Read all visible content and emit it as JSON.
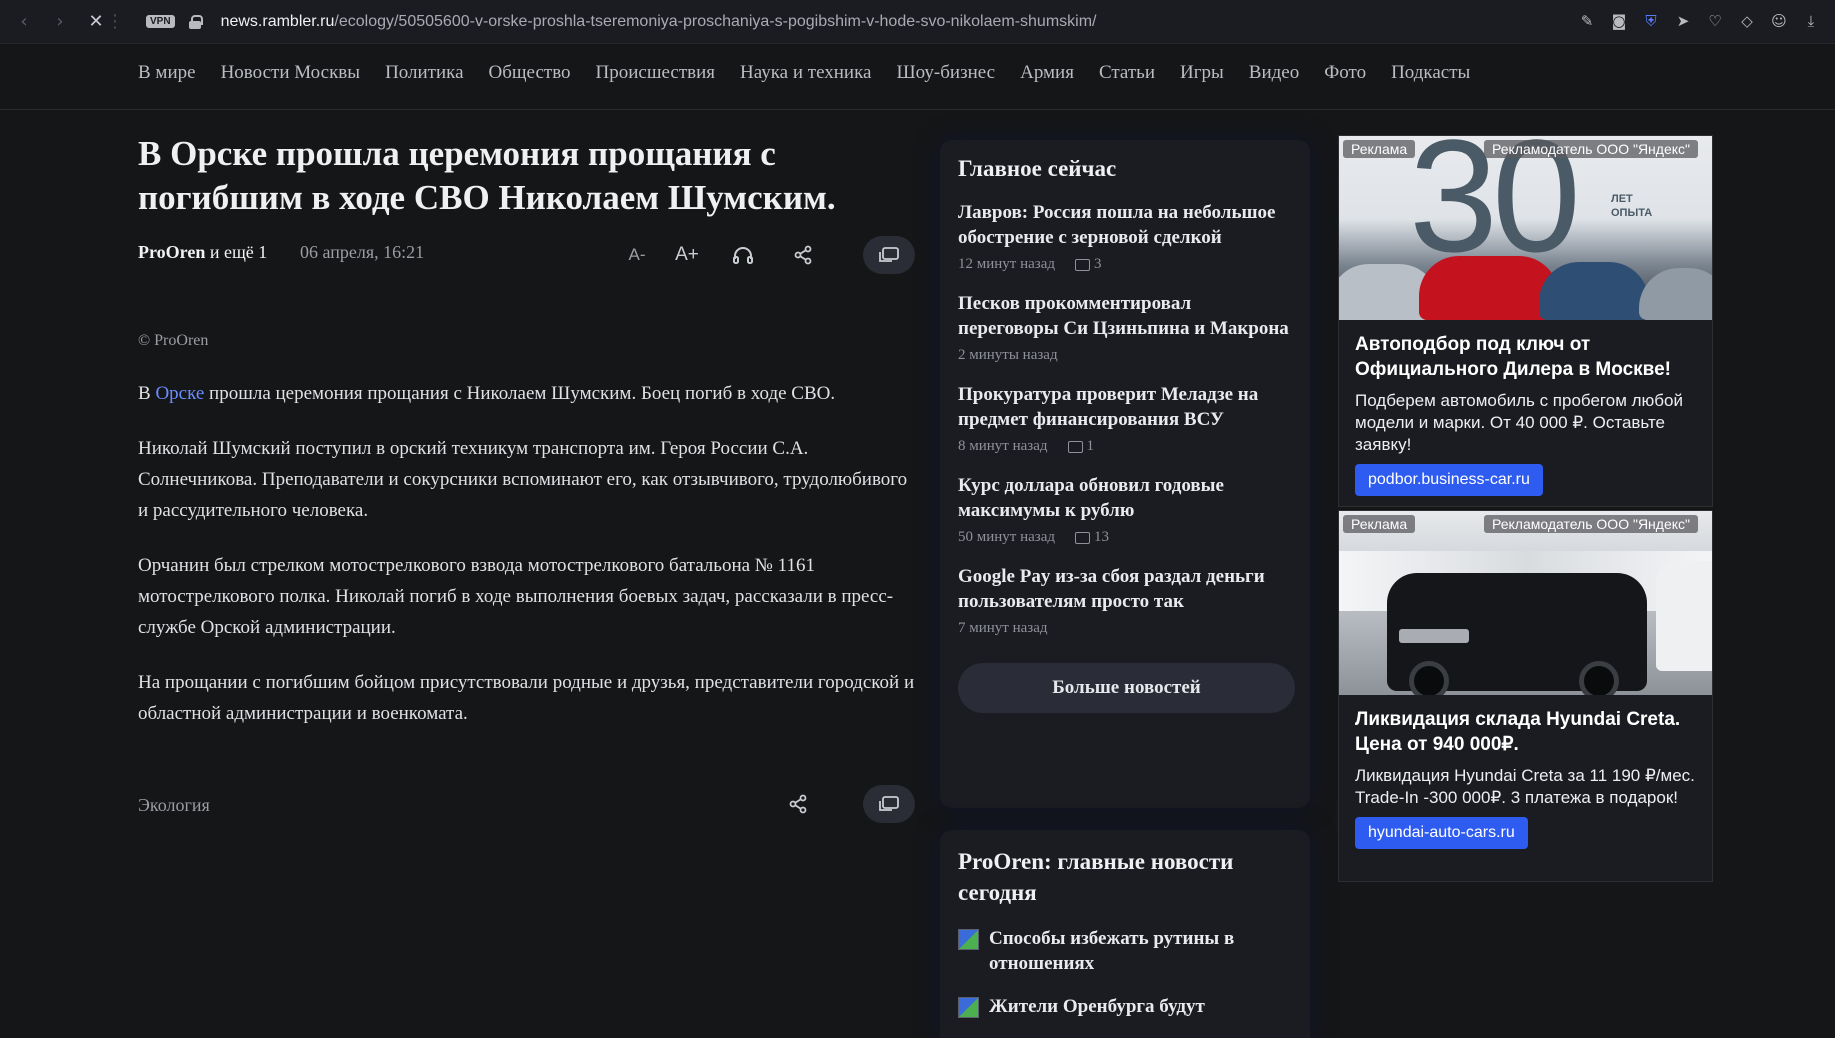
{
  "browser": {
    "vpn_label": "VPN",
    "url_domain": "news.rambler.ru",
    "url_path": "/ecology/50505600-v-orske-proshla-tseremoniya-proschaniya-s-pogibshim-v-hode-svo-nikolaem-shumskim/"
  },
  "nav": {
    "items": [
      "В мире",
      "Новости Москвы",
      "Политика",
      "Общество",
      "Происшествия",
      "Наука и техника",
      "Шоу-бизнес",
      "Армия",
      "Статьи",
      "Игры",
      "Видео",
      "Фото",
      "Подкасты"
    ]
  },
  "article": {
    "headline": "В Орске прошла церемония прощания с погибшим в ходе СВО Николаем Шумским.",
    "source": "ProOren",
    "source_more": "и ещё 1",
    "date": "06 апреля, 16:21",
    "font_minus": "A-",
    "font_plus": "A+",
    "copyright": "© ProOren",
    "p1_before": "В ",
    "p1_link": "Орске",
    "p1_after": " прошла церемония прощания с Николаем Шумским. Боец погиб в ходе СВО.",
    "p2": "Николай Шумский поступил в орский техникум транспорта им. Героя России С.А. Солнечникова. Преподаватели и сокурсники вспоминают его, как отзывчивого, трудолюбивого и рассудительного человека.",
    "p3": "Орчанин был стрелком мотострелкового взвода мотострелкового батальона № 1161 мотострелкового полка. Николай погиб в ходе выполнения боевых задач, рассказали в пресс-службе Орской администрации.",
    "p4": "На прощании с погибшим бойцом присутствовали родные и друзья, представители городской и областной администрации и военкомата.",
    "rubric": "Экология"
  },
  "main_now": {
    "title": "Главное сейчас",
    "items": [
      {
        "title": "Лавров: Россия пошла на небольшое обострение с зерновой сделкой",
        "time": "12 минут назад",
        "comments": "3"
      },
      {
        "title": "Песков прокомментировал переговоры Си Цзиньпина и Макрона",
        "time": "2 минуты назад",
        "comments": ""
      },
      {
        "title": "Прокуратура проверит Меладзе на предмет финансирования ВСУ",
        "time": "8 минут назад",
        "comments": "1"
      },
      {
        "title": "Курс доллара обновил годовые максимумы к рублю",
        "time": "50 минут назад",
        "comments": "13"
      },
      {
        "title": "Google Pay из-за сбоя раздал деньги пользователям просто так",
        "time": "7 минут назад",
        "comments": ""
      }
    ],
    "more_button": "Больше новостей"
  },
  "prooren": {
    "title": "ProOren: главные новости сегодня",
    "items": [
      "Способы избежать рутины в отношениях",
      "Жители Оренбурга будут"
    ]
  },
  "ads": [
    {
      "label": "Реклама",
      "advertiser": "Рекламодатель ООО \"Яндекс\"",
      "big_number": "30",
      "badge_line1": "ЛЕТ",
      "badge_line2": "ОПЫТА",
      "title": "Автоподбор под ключ от Официального Дилера в Москве!",
      "text": "Подберем автомобиль с пробегом любой модели и марки. От 40 000 ₽. Оставьте заявку!",
      "button": "podbor.business-car.ru"
    },
    {
      "label": "Реклама",
      "advertiser": "Рекламодатель ООО \"Яндекс\"",
      "title": "Ликвидация склада Hyundai Creta. Цена от 940 000₽.",
      "text": "Ликвидация Hyundai Creta за 11 190 ₽/мес. Trade-In -300 000₽. 3 платежа в подарок!",
      "button": "hyundai-auto-cars.ru"
    }
  ]
}
